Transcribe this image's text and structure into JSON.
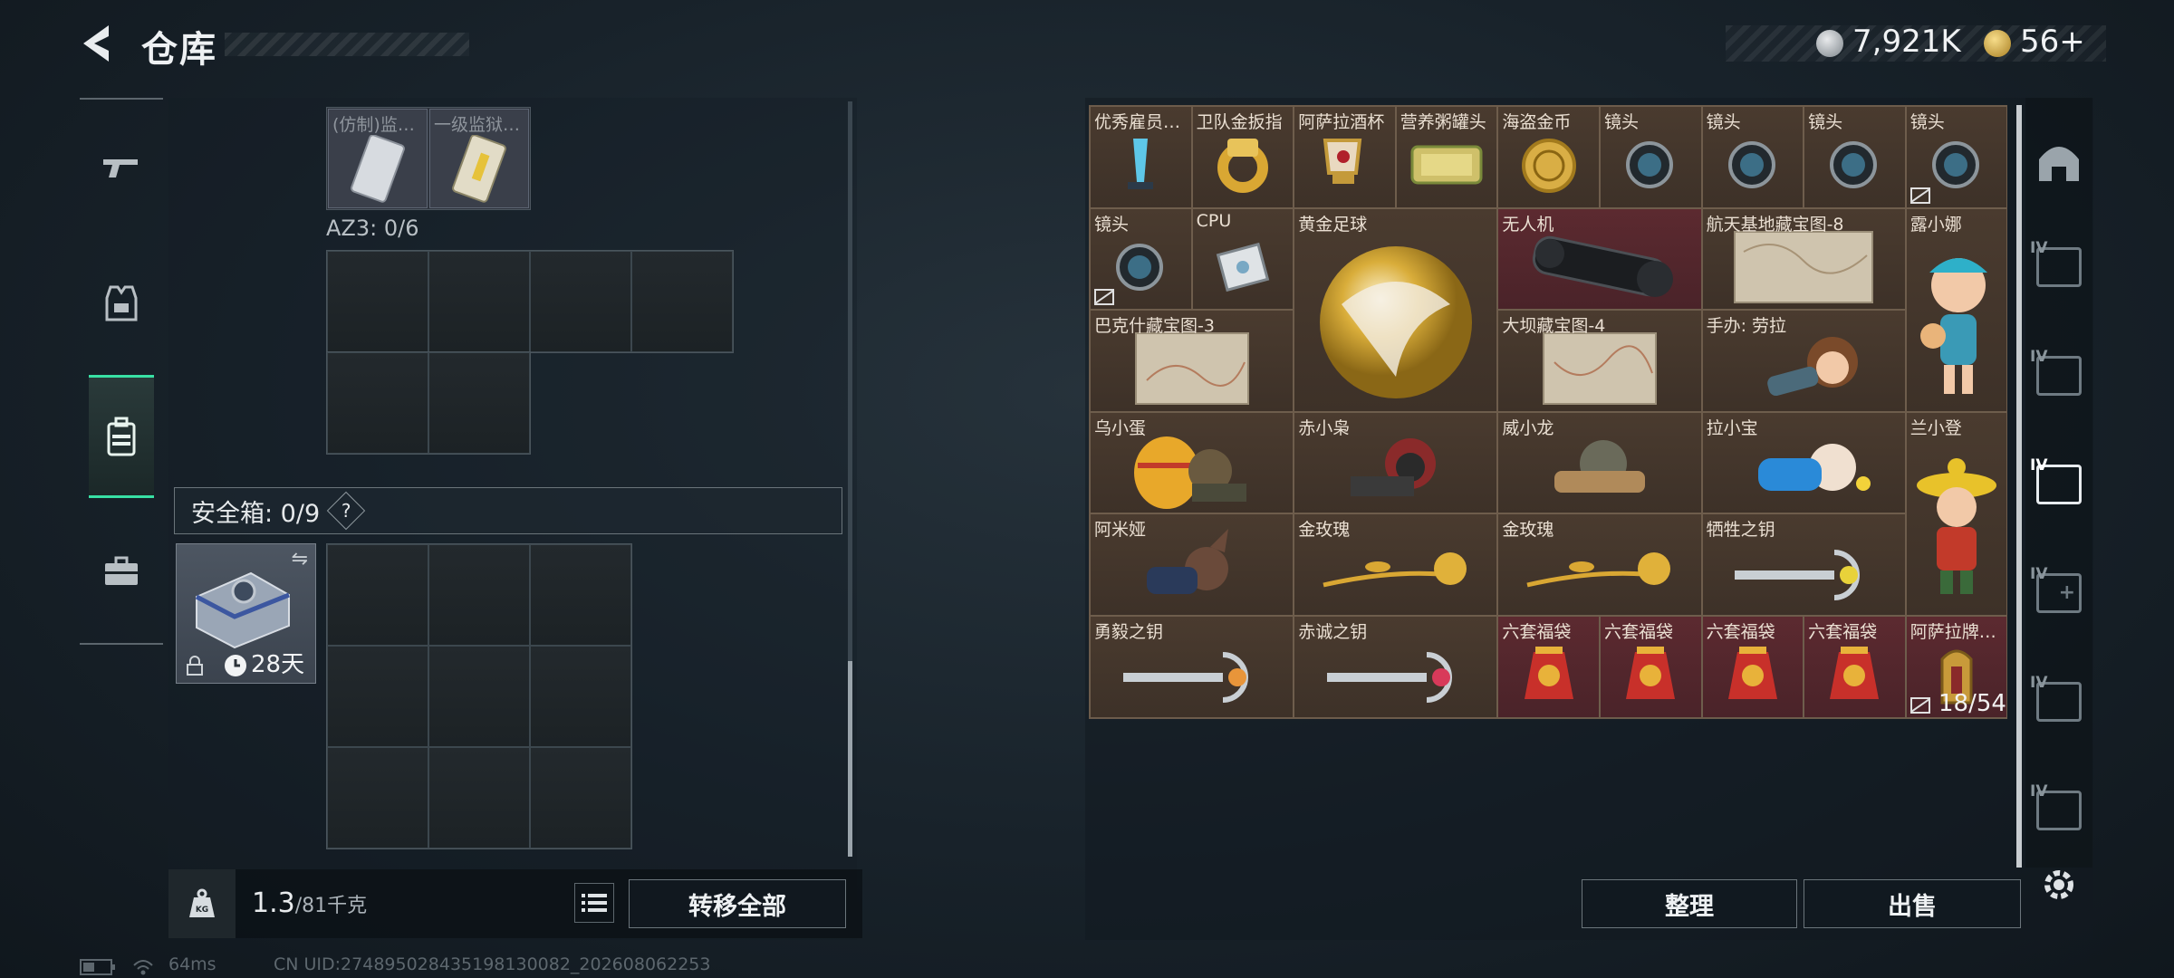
{
  "header": {
    "title": "仓库",
    "currencies": [
      {
        "icon": "silver-coin-icon",
        "value": "7,921K"
      },
      {
        "icon": "gold-coin-icon",
        "value": "56+"
      }
    ]
  },
  "left_tabs": [
    {
      "icon": "gun-icon",
      "active": false
    },
    {
      "icon": "vest-icon",
      "active": false
    },
    {
      "icon": "backpack-icon",
      "active": true
    },
    {
      "icon": "briefcase-icon",
      "active": false
    }
  ],
  "left_panel": {
    "top_items": [
      {
        "name": "(仿制)监…"
      },
      {
        "name": "一级监狱…"
      }
    ],
    "az3_label": "AZ3: 0/6",
    "safe_header": "安全箱: 0/9",
    "safe_help": "?",
    "safebox_timer": "28天",
    "weight_current": "1.3",
    "weight_max": "/81千克",
    "transfer_all": "转移全部"
  },
  "stash": {
    "items": [
      {
        "name": "优秀雇员…",
        "red": false
      },
      {
        "name": "卫队金扳指",
        "red": false
      },
      {
        "name": "阿萨拉酒杯",
        "red": false
      },
      {
        "name": "营养粥罐头",
        "red": false
      },
      {
        "name": "海盗金币",
        "red": false
      },
      {
        "name": "镜头",
        "red": false
      },
      {
        "name": "镜头",
        "red": false
      },
      {
        "name": "镜头",
        "red": false
      },
      {
        "name": "镜头",
        "red": false
      },
      {
        "name": "镜头",
        "red": false
      },
      {
        "name": "CPU",
        "red": false
      },
      {
        "name": "黄金足球",
        "red": false
      },
      {
        "name": "无人机",
        "red": true
      },
      {
        "name": "航天基地藏宝图-8",
        "red": false
      },
      {
        "name": "露小娜",
        "red": false
      },
      {
        "name": "巴克什藏宝图-3",
        "red": false
      },
      {
        "name": "大坝藏宝图-4",
        "red": false
      },
      {
        "name": "手办: 劳拉",
        "red": false
      },
      {
        "name": "乌小蛋",
        "red": false
      },
      {
        "name": "赤小枭",
        "red": false
      },
      {
        "name": "威小龙",
        "red": false
      },
      {
        "name": "拉小宝",
        "red": false
      },
      {
        "name": "兰小登",
        "red": false
      },
      {
        "name": "阿米娅",
        "red": false
      },
      {
        "name": "金玫瑰",
        "red": false
      },
      {
        "name": "金玫瑰",
        "red": false
      },
      {
        "name": "牺牲之钥",
        "red": false
      },
      {
        "name": "勇毅之钥",
        "red": false
      },
      {
        "name": "赤诚之钥",
        "red": false
      },
      {
        "name": "六套福袋",
        "red": true
      },
      {
        "name": "六套福袋",
        "red": true
      },
      {
        "name": "六套福袋",
        "red": true
      },
      {
        "name": "六套福袋",
        "red": true
      },
      {
        "name": "阿萨拉牌…",
        "red": true
      }
    ],
    "count": "18/54",
    "sort_button": "整理",
    "sell_button": "出售"
  },
  "side_icons": [
    {
      "icon": "helmet-icon",
      "level": "",
      "active": false
    },
    {
      "icon": "armor-level-icon",
      "level": "IV",
      "active": false
    },
    {
      "icon": "armor-level-icon",
      "level": "IV",
      "active": false
    },
    {
      "icon": "armor-level-icon",
      "level": "IV",
      "active": true
    },
    {
      "icon": "medkit-level-icon",
      "level": "IV",
      "active": false
    },
    {
      "icon": "bag-level-icon",
      "level": "IV",
      "active": false
    },
    {
      "icon": "chest-level-icon",
      "level": "IV",
      "active": false
    }
  ],
  "status": {
    "ping": "64ms",
    "uid": "CN UID:274895028435198130082_202608062253"
  }
}
